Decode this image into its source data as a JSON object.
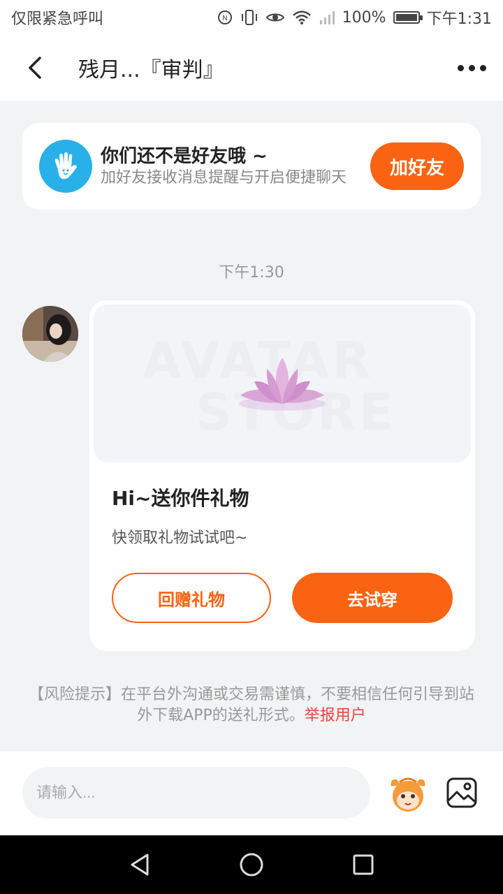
{
  "status_bar": {
    "carrier": "仅限紧急呼叫",
    "battery": "100%",
    "battery_level": 1.0,
    "time": "下午1:31",
    "icons": [
      "nfc-icon",
      "vibrate-icon",
      "eye-icon",
      "wifi-icon",
      "signal-icon",
      "battery-icon"
    ]
  },
  "nav": {
    "title": "残月...『审判』"
  },
  "friend_banner": {
    "title": "你们还不是好友哦 ~",
    "subtitle": "加好友接收消息提醒与开启便捷聊天",
    "button": "加好友"
  },
  "chat": {
    "timestamp": "下午1:30",
    "gift": {
      "watermark_top": "AVATAR",
      "watermark_bottom": "STORE",
      "title": "Hi~送你件礼物",
      "desc": "快领取礼物试试吧~",
      "return_button": "回赠礼物",
      "try_button": "去试穿"
    }
  },
  "risk_notice": {
    "text": "【风险提示】在平台外沟通或交易需谨慎，不要相信任何引导到站外下载APP的送礼形式。",
    "link": "举报用户"
  },
  "input_bar": {
    "placeholder": "请输入..."
  },
  "colors": {
    "accent": "#fa6312",
    "report": "#f04040",
    "wave_bg": "#2ab0e8"
  }
}
